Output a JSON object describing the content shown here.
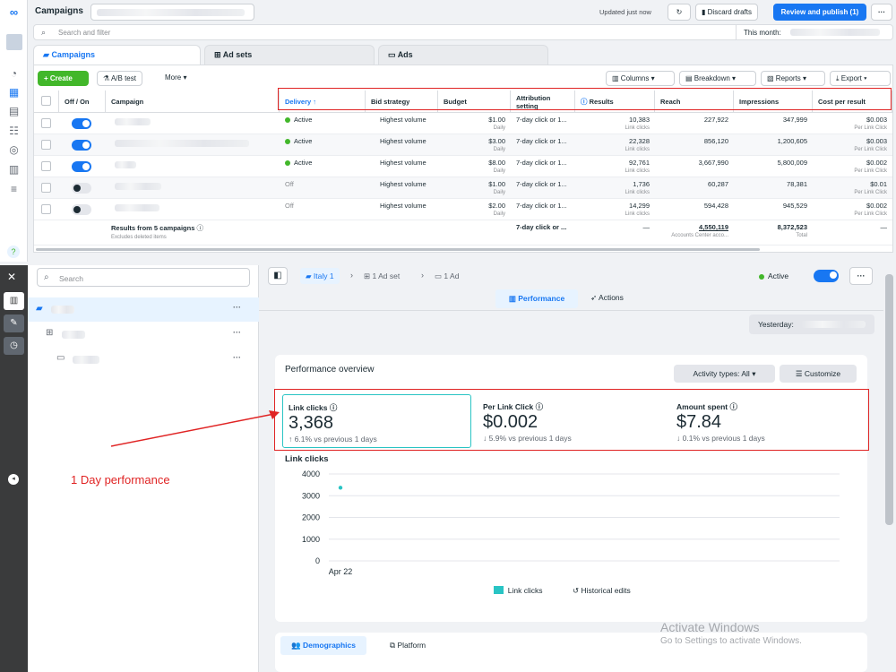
{
  "header": {
    "section_title": "Campaigns",
    "updated": "Updated just now",
    "discard_label": "Discard drafts",
    "publish_label": "Review and publish (1)",
    "more": "···"
  },
  "search": {
    "placeholder": "Search and filter",
    "date_label": "This month:"
  },
  "tabs": [
    {
      "label": "Campaigns"
    },
    {
      "label": "Ad sets"
    },
    {
      "label": "Ads"
    }
  ],
  "toolbar": {
    "create": "Create",
    "ab_test": "A/B test",
    "more": "More",
    "columns": "Columns",
    "breakdown": "Breakdown",
    "reports": "Reports",
    "export": "Export"
  },
  "table": {
    "headers": {
      "offon": "Off / On",
      "campaign": "Campaign",
      "delivery": "Delivery",
      "bid": "Bid strategy",
      "budget": "Budget",
      "attribution": "Attribution setting",
      "results": "Results",
      "reach": "Reach",
      "impressions": "Impressions",
      "cpr": "Cost per result"
    },
    "rows": [
      {
        "on": true,
        "delivery": "Active",
        "bid": "Highest volume",
        "budget": "$1.00",
        "budget_sub": "Daily",
        "attribution": "7-day click or 1...",
        "results": "10,383",
        "results_sub": "Link clicks",
        "reach": "227,922",
        "impressions": "347,999",
        "cpr": "$0.003",
        "cpr_sub": "Per Link Click"
      },
      {
        "on": true,
        "delivery": "Active",
        "bid": "Highest volume",
        "budget": "$3.00",
        "budget_sub": "Daily",
        "attribution": "7-day click or 1...",
        "results": "22,328",
        "results_sub": "Link clicks",
        "reach": "856,120",
        "impressions": "1,200,605",
        "cpr": "$0.003",
        "cpr_sub": "Per Link Click"
      },
      {
        "on": true,
        "delivery": "Active",
        "bid": "Highest volume",
        "budget": "$8.00",
        "budget_sub": "Daily",
        "attribution": "7-day click or 1...",
        "results": "92,761",
        "results_sub": "Link clicks",
        "reach": "3,667,990",
        "impressions": "5,800,009",
        "cpr": "$0.002",
        "cpr_sub": "Per Link Click"
      },
      {
        "on": false,
        "delivery": "Off",
        "bid": "Highest volume",
        "budget": "$1.00",
        "budget_sub": "Daily",
        "attribution": "7-day click or 1...",
        "results": "1,736",
        "results_sub": "Link clicks",
        "reach": "60,287",
        "impressions": "78,381",
        "cpr": "$0.01",
        "cpr_sub": "Per Link Click"
      },
      {
        "on": false,
        "delivery": "Off",
        "bid": "Highest volume",
        "budget": "$2.00",
        "budget_sub": "Daily",
        "attribution": "7-day click or 1...",
        "results": "14,299",
        "results_sub": "Link clicks",
        "reach": "594,428",
        "impressions": "945,529",
        "cpr": "$0.002",
        "cpr_sub": "Per Link Click"
      }
    ],
    "summary": {
      "label": "Results from 5 campaigns",
      "sub": "Excludes deleted items",
      "attribution": "7-day click or ...",
      "results": "—",
      "reach": "4,550,119",
      "reach_sub": "Accounts Center acco...",
      "impressions": "8,372,523",
      "impressions_sub": "Total",
      "cpr": "—"
    }
  },
  "tree": {
    "search_placeholder": "Search",
    "more": "···"
  },
  "detail": {
    "breadcrumb": {
      "campaign": "Italy 1",
      "adset": "1 Ad set",
      "ad": "1 Ad"
    },
    "status": "Active",
    "tabs": {
      "performance": "Performance",
      "actions": "Actions"
    },
    "date_label": "Yesterday:",
    "overview_title": "Performance overview",
    "activity_types": "Activity types: All",
    "customize": "Customize",
    "metrics": [
      {
        "label": "Link clicks",
        "value": "3,368",
        "change": "6.1% vs previous 1 days",
        "arrow": "↑"
      },
      {
        "label": "Per Link Click",
        "value": "$0.002",
        "change": "5.9% vs previous 1 days",
        "arrow": "↓"
      },
      {
        "label": "Amount spent",
        "value": "$7.84",
        "change": "0.1% vs previous 1 days",
        "arrow": "↓"
      }
    ],
    "chart_title": "Link clicks",
    "legend_link_clicks": "Link clicks",
    "legend_historical": "Historical edits",
    "bottom_tabs": {
      "demographics": "Demographics",
      "platform": "Platform"
    }
  },
  "annotation": {
    "text": "1 Day performance",
    "color": "#e02424"
  },
  "watermark": {
    "line1": "Activate Windows",
    "line2": "Go to Settings to activate Windows."
  },
  "colors": {
    "accent": "#1877f2",
    "create": "#42b72a",
    "series": "#29c4c4",
    "annotation": "#e02424"
  },
  "chart_data": {
    "type": "scatter",
    "title": "Link clicks",
    "categories": [
      "Apr 22"
    ],
    "series": [
      {
        "name": "Link clicks",
        "values": [
          3368
        ]
      }
    ],
    "ylim": [
      0,
      4000
    ],
    "yticks": [
      0,
      1000,
      2000,
      3000,
      4000
    ],
    "grid": true,
    "legend": "bottom"
  }
}
